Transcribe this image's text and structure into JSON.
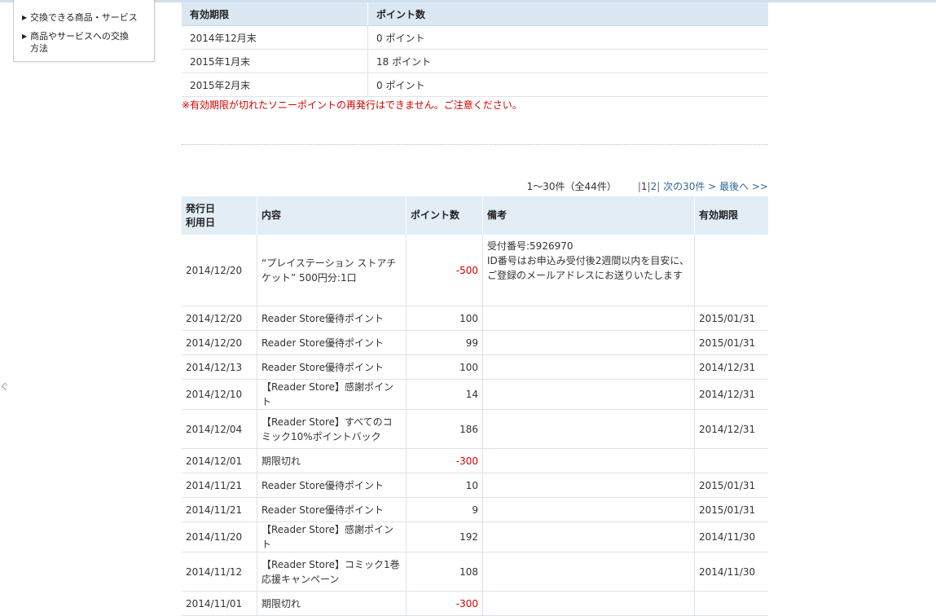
{
  "sidebar": {
    "items": [
      {
        "label": "交換できる商品・サービス"
      },
      {
        "label": "商品やサービスへの交換方法"
      }
    ]
  },
  "edge_text": "ぐ",
  "expiry_table": {
    "headers": [
      "有効期限",
      "ポイント数"
    ],
    "rows": [
      {
        "period": "2014年12月末",
        "points": "0 ポイント"
      },
      {
        "period": "2015年1月末",
        "points": "18 ポイント"
      },
      {
        "period": "2015年2月末",
        "points": "0 ポイント"
      }
    ]
  },
  "notice": "※有効期限が切れたソニーポイントの再発行はできません。ご注意ください。",
  "pager": {
    "count": "1〜30件（全44件）",
    "page1": "1",
    "page2": "2",
    "next": "次の30件 >",
    "last": "最後へ >>"
  },
  "history_table": {
    "headers": {
      "date_line1": "発行日",
      "date_line2": "利用日",
      "content": "内容",
      "points": "ポイント数",
      "note": "備考",
      "expiry": "有効期限"
    },
    "rows": [
      {
        "date": "2014/12/20",
        "content": "“プレイステーション ストアチケット” 500円分:1口",
        "points": "-500",
        "note": "受付番号:5926970\nID番号はお申込み受付後2週間以内を目安に、ご登録のメールアドレスにお送りいたします",
        "expiry": ""
      },
      {
        "date": "2014/12/20",
        "content": "Reader Store優待ポイント",
        "points": "100",
        "note": "",
        "expiry": "2015/01/31"
      },
      {
        "date": "2014/12/20",
        "content": "Reader Store優待ポイント",
        "points": "99",
        "note": "",
        "expiry": "2015/01/31"
      },
      {
        "date": "2014/12/13",
        "content": "Reader Store優待ポイント",
        "points": "100",
        "note": "",
        "expiry": "2014/12/31"
      },
      {
        "date": "2014/12/10",
        "content": "【Reader Store】感謝ポイント",
        "points": "14",
        "note": "",
        "expiry": "2014/12/31"
      },
      {
        "date": "2014/12/04",
        "content": "【Reader Store】すべてのコミック10%ポイントバック",
        "points": "186",
        "note": "",
        "expiry": "2014/12/31"
      },
      {
        "date": "2014/12/01",
        "content": "期限切れ",
        "points": "-300",
        "note": "",
        "expiry": ""
      },
      {
        "date": "2014/11/21",
        "content": "Reader Store優待ポイント",
        "points": "10",
        "note": "",
        "expiry": "2015/01/31"
      },
      {
        "date": "2014/11/21",
        "content": "Reader Store優待ポイント",
        "points": "9",
        "note": "",
        "expiry": "2015/01/31"
      },
      {
        "date": "2014/11/20",
        "content": "【Reader Store】感謝ポイント",
        "points": "192",
        "note": "",
        "expiry": "2014/11/30"
      },
      {
        "date": "2014/11/12",
        "content": "【Reader Store】コミック1巻応援キャンペーン",
        "points": "108",
        "note": "",
        "expiry": "2014/11/30"
      },
      {
        "date": "2014/11/01",
        "content": "期限切れ",
        "points": "-300",
        "note": "",
        "expiry": ""
      }
    ]
  },
  "colors": {
    "header_bg": "#dbe8f3",
    "negative": "#d40000",
    "link": "#336699"
  }
}
